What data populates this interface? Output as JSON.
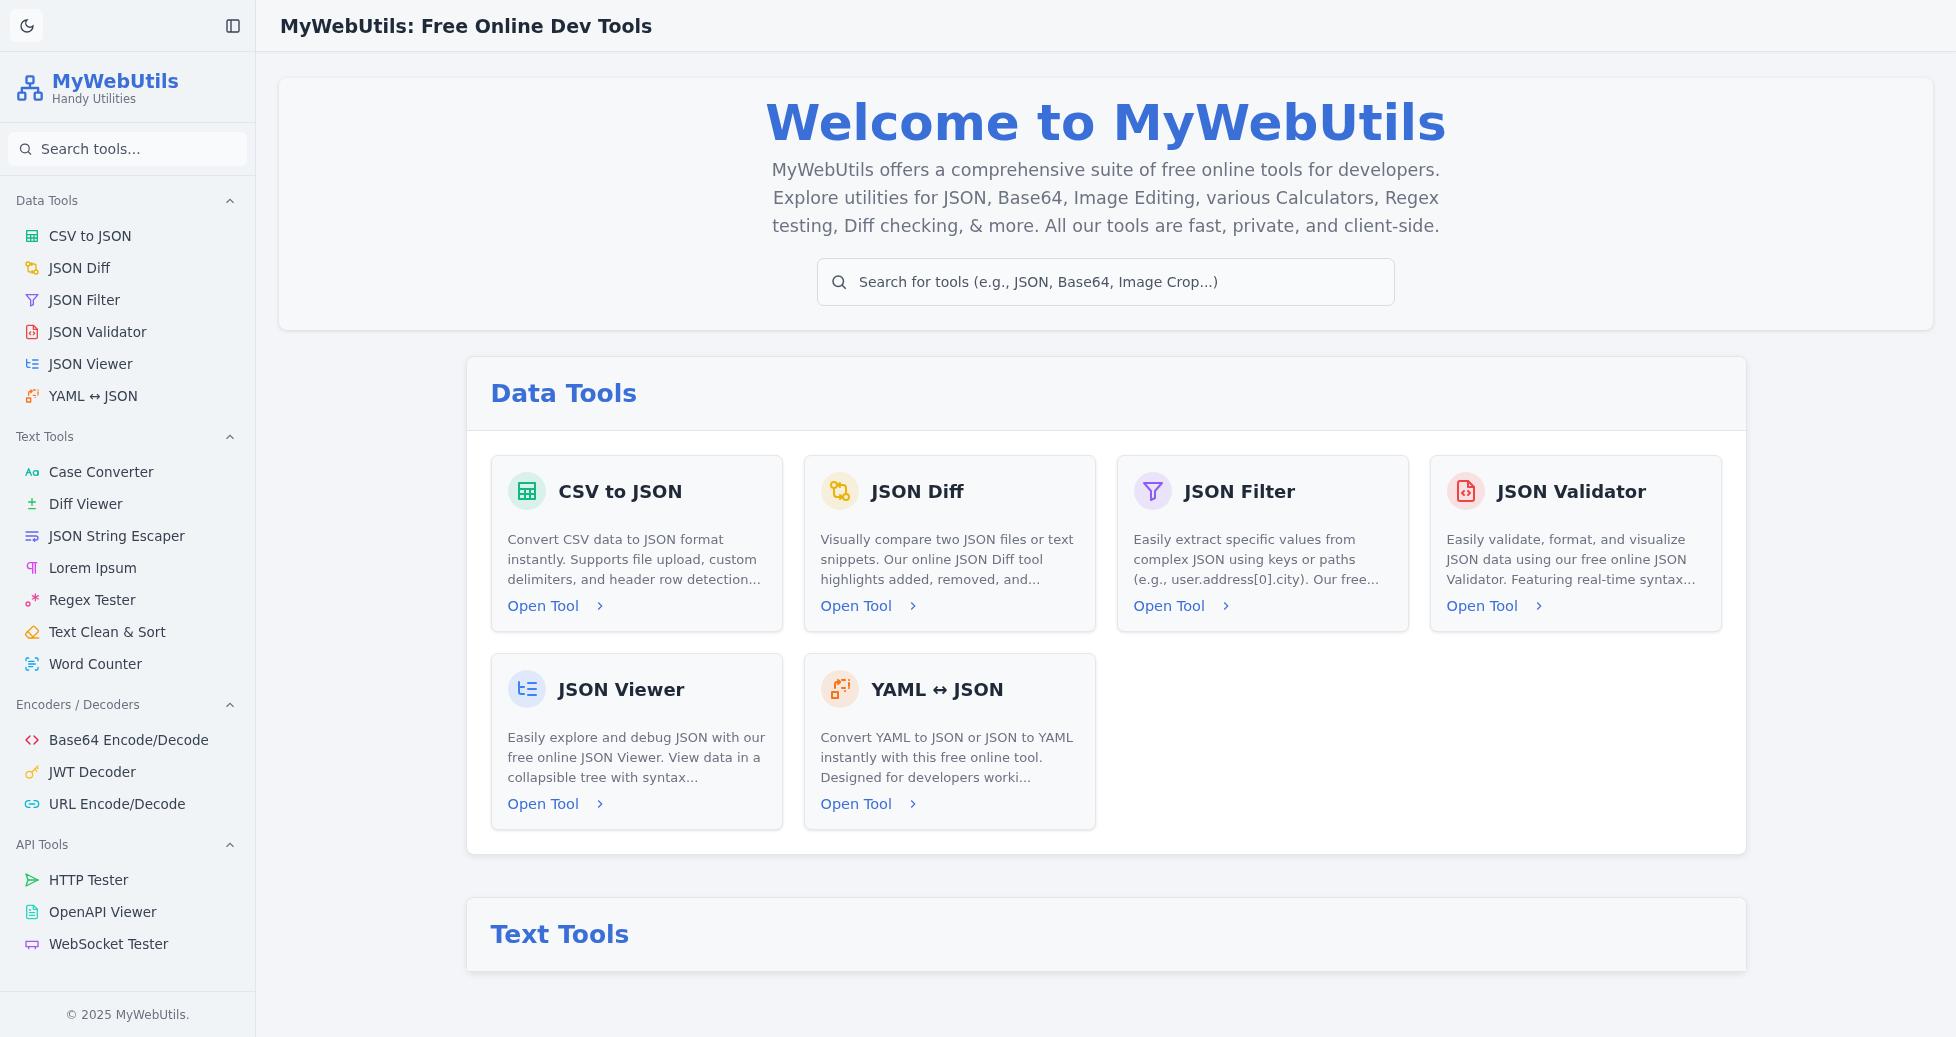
{
  "sidebar": {
    "brand": {
      "name": "MyWebUtils",
      "tagline": "Handy Utilities"
    },
    "search": {
      "placeholder": "Search tools..."
    },
    "sections": [
      {
        "title": "Data Tools",
        "expanded": true,
        "items": [
          {
            "label": "CSV to JSON",
            "kind": "table"
          },
          {
            "label": "JSON Diff",
            "kind": "diff"
          },
          {
            "label": "JSON Filter",
            "kind": "filter"
          },
          {
            "label": "JSON Validator",
            "kind": "filecode"
          },
          {
            "label": "JSON Viewer",
            "kind": "list"
          },
          {
            "label": "YAML ↔ JSON",
            "kind": "convert"
          }
        ]
      },
      {
        "title": "Text Tools",
        "expanded": true,
        "items": [
          {
            "label": "Case Converter",
            "kind": "case"
          },
          {
            "label": "Diff Viewer",
            "kind": "plusminus"
          },
          {
            "label": "JSON String Escaper",
            "kind": "wrap"
          },
          {
            "label": "Lorem Ipsum",
            "kind": "pilcrow"
          },
          {
            "label": "Regex Tester",
            "kind": "regex"
          },
          {
            "label": "Text Clean & Sort",
            "kind": "eraser"
          },
          {
            "label": "Word Counter",
            "kind": "scantext"
          }
        ]
      },
      {
        "title": "Encoders / Decoders",
        "expanded": true,
        "items": [
          {
            "label": "Base64 Encode/Decode",
            "kind": "code"
          },
          {
            "label": "JWT Decoder",
            "kind": "key"
          },
          {
            "label": "URL Encode/Decode",
            "kind": "link"
          }
        ]
      },
      {
        "title": "API Tools",
        "expanded": true,
        "items": [
          {
            "label": "HTTP Tester",
            "kind": "send"
          },
          {
            "label": "OpenAPI Viewer",
            "kind": "filetext"
          },
          {
            "label": "WebSocket Tester",
            "kind": "socket"
          }
        ]
      }
    ],
    "footer": "© 2025 MyWebUtils."
  },
  "header": {
    "title": "MyWebUtils: Free Online Dev Tools"
  },
  "hero": {
    "title": "Welcome to MyWebUtils",
    "text": "MyWebUtils offers a comprehensive suite of free online tools for developers. Explore utilities for JSON, Base64, Image Editing, various Calculators, Regex testing, Diff checking, & more. All our tools are fast, private, and client-side.",
    "search": {
      "placeholder": "Search for tools (e.g., JSON, Base64, Image Crop...)"
    }
  },
  "categories": [
    {
      "title": "Data Tools",
      "cards": [
        {
          "title": "CSV to JSON",
          "kind": "table",
          "description": "Convert CSV data to JSON format instantly. Supports file upload, custom delimiters, and header row detection...",
          "link": "Open Tool"
        },
        {
          "title": "JSON Diff",
          "kind": "diff",
          "description": "Visually compare two JSON files or text snippets. Our online JSON Diff tool highlights added, removed, and...",
          "link": "Open Tool"
        },
        {
          "title": "JSON Filter",
          "kind": "filter",
          "description": "Easily extract specific values from complex JSON using keys or paths (e.g., user.address[0].city). Our free...",
          "link": "Open Tool"
        },
        {
          "title": "JSON Validator",
          "kind": "filecode",
          "description": "Easily validate, format, and visualize JSON data using our free online JSON Validator. Featuring real-time syntax...",
          "link": "Open Tool"
        },
        {
          "title": "JSON Viewer",
          "kind": "list",
          "description": "Easily explore and debug JSON with our free online JSON Viewer. View data in a collapsible tree with syntax...",
          "link": "Open Tool"
        },
        {
          "title": "YAML ↔ JSON",
          "kind": "convert",
          "description": "Convert YAML to JSON or JSON to YAML instantly with this free online tool. Designed for developers worki...",
          "link": "Open Tool"
        }
      ]
    },
    {
      "title": "Text Tools"
    }
  ]
}
